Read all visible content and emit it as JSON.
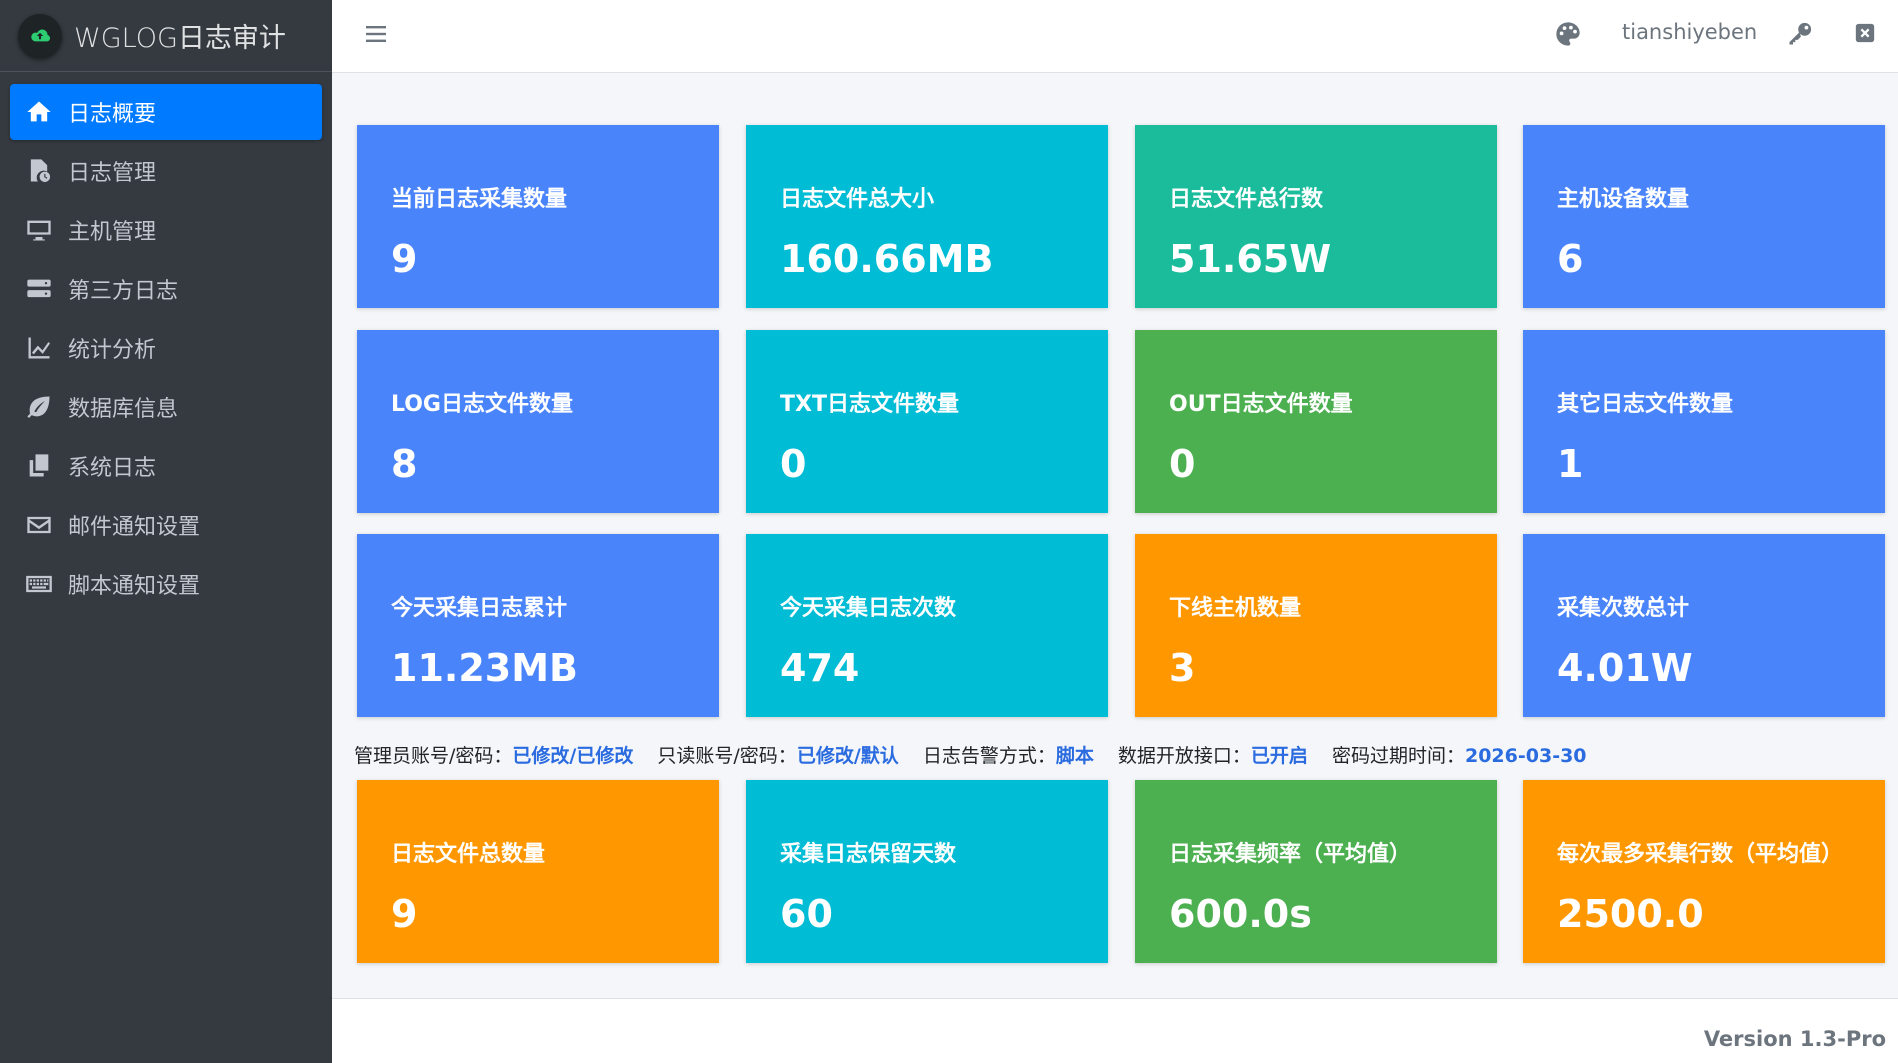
{
  "app": {
    "title": "WGLOG日志审计"
  },
  "sidebar": {
    "items": [
      {
        "label": "日志概要",
        "icon": "home-icon",
        "active": true
      },
      {
        "label": "日志管理",
        "icon": "file-clock-icon"
      },
      {
        "label": "主机管理",
        "icon": "desktop-icon"
      },
      {
        "label": "第三方日志",
        "icon": "server-icon"
      },
      {
        "label": "统计分析",
        "icon": "chart-line-icon"
      },
      {
        "label": "数据库信息",
        "icon": "leaf-icon"
      },
      {
        "label": "系统日志",
        "icon": "copy-icon"
      },
      {
        "label": "邮件通知设置",
        "icon": "envelope-icon"
      },
      {
        "label": "脚本通知设置",
        "icon": "keyboard-icon"
      }
    ]
  },
  "header": {
    "username": "tianshiyeben"
  },
  "cards": [
    {
      "label": "当前日志采集数量",
      "value": "9",
      "color": "#4a84fb"
    },
    {
      "label": "日志文件总大小",
      "value": "160.66MB",
      "color": "#00bcd4"
    },
    {
      "label": "日志文件总行数",
      "value": "51.65W",
      "color": "#1abc9c"
    },
    {
      "label": "主机设备数量",
      "value": "6",
      "color": "#4a84fb"
    },
    {
      "label": "LOG日志文件数量",
      "value": "8",
      "color": "#4a84fb"
    },
    {
      "label": "TXT日志文件数量",
      "value": "0",
      "color": "#00bcd4"
    },
    {
      "label": "OUT日志文件数量",
      "value": "0",
      "color": "#4caf50"
    },
    {
      "label": "其它日志文件数量",
      "value": "1",
      "color": "#4a84fb"
    },
    {
      "label": "今天采集日志累计",
      "value": "11.23MB",
      "color": "#4a84fb"
    },
    {
      "label": "今天采集日志次数",
      "value": "474",
      "color": "#00bcd4"
    },
    {
      "label": "下线主机数量",
      "value": "3",
      "color": "#ff9800"
    },
    {
      "label": "采集次数总计",
      "value": "4.01W",
      "color": "#4a84fb"
    },
    {
      "label": "日志文件总数量",
      "value": "9",
      "color": "#ff9800"
    },
    {
      "label": "采集日志保留天数",
      "value": "60",
      "color": "#00bcd4"
    },
    {
      "label": "日志采集频率（平均值）",
      "value": "600.0s",
      "color": "#4caf50"
    },
    {
      "label": "每次最多采集行数（平均值）",
      "value": "2500.0",
      "color": "#ff9800"
    }
  ],
  "info": {
    "admin_label": "管理员账号/密码：",
    "admin_value": "已修改/已修改",
    "readonly_label": "只读账号/密码：",
    "readonly_value": "已修改/默认",
    "alert_label": "日志告警方式：",
    "alert_value": "脚本",
    "api_label": "数据开放接口：",
    "api_value": "已开启",
    "expire_label": "密码过期时间：",
    "expire_value": "2026-03-30"
  },
  "footer": {
    "version": "Version 1.3-Pro"
  }
}
